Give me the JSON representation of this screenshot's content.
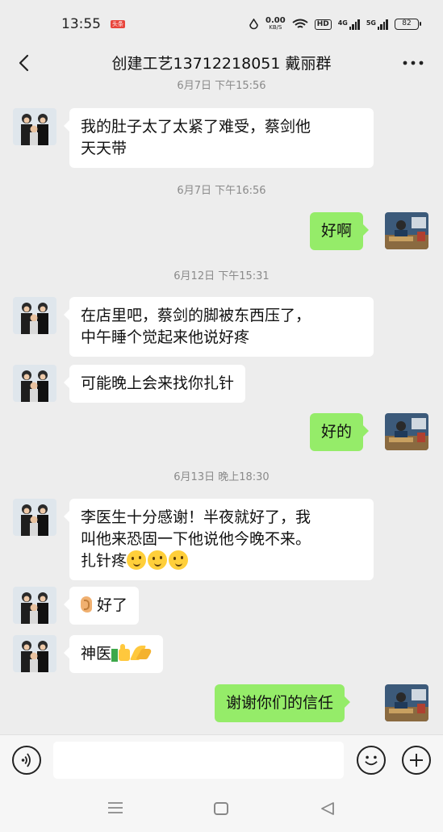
{
  "status_bar": {
    "time": "13:55",
    "badge": "头条",
    "net_speed_value": "0.00",
    "net_speed_unit": "KB/S",
    "hd_label": "HD",
    "signal1_type": "4G",
    "signal2_type": "5G",
    "battery": "82"
  },
  "header": {
    "title": "创建工艺13712218051  戴丽群",
    "back_icon": "chevron-left-icon",
    "more_icon": "more-icon"
  },
  "chat": {
    "partial_timestamp": "6月7日 下午15:56",
    "messages": [
      {
        "side": "in",
        "text": "我的肚子太了太紧了难受，蔡剑他\n天天带"
      },
      {
        "timestamp": "6月7日 下午16:56"
      },
      {
        "side": "out",
        "text": "好啊"
      },
      {
        "timestamp": "6月12日 下午15:31"
      },
      {
        "side": "in",
        "text": "在店里吧，蔡剑的脚被东西压了，\n中午睡个觉起来他说好疼"
      },
      {
        "side": "in",
        "text": "可能晚上会来找你扎针"
      },
      {
        "side": "out",
        "text": "好的"
      },
      {
        "timestamp": "6月13日 晚上18:30"
      },
      {
        "side": "in",
        "text_line1": "李医生十分感谢！半夜就好了，我",
        "text_line2": "叫他来恐固一下他说他今晚不来。",
        "text_line3": "扎针疼",
        "emoji": "thinking-face",
        "emoji_count": 3
      },
      {
        "side": "in",
        "text": "好了",
        "emoji": "ear"
      },
      {
        "side": "in",
        "text": "神医",
        "emoji": [
          "thumbs-up",
          "folded-hands"
        ]
      },
      {
        "side": "out",
        "text": "谢谢你们的信任"
      }
    ]
  },
  "input_bar": {
    "voice_icon": "voice-icon",
    "placeholder": "",
    "emoji_icon": "emoji-icon",
    "plus_icon": "plus-icon"
  },
  "nav_bar": {
    "menu_icon": "menu-icon",
    "home_icon": "home-icon",
    "back_icon": "back-triangle-icon"
  }
}
